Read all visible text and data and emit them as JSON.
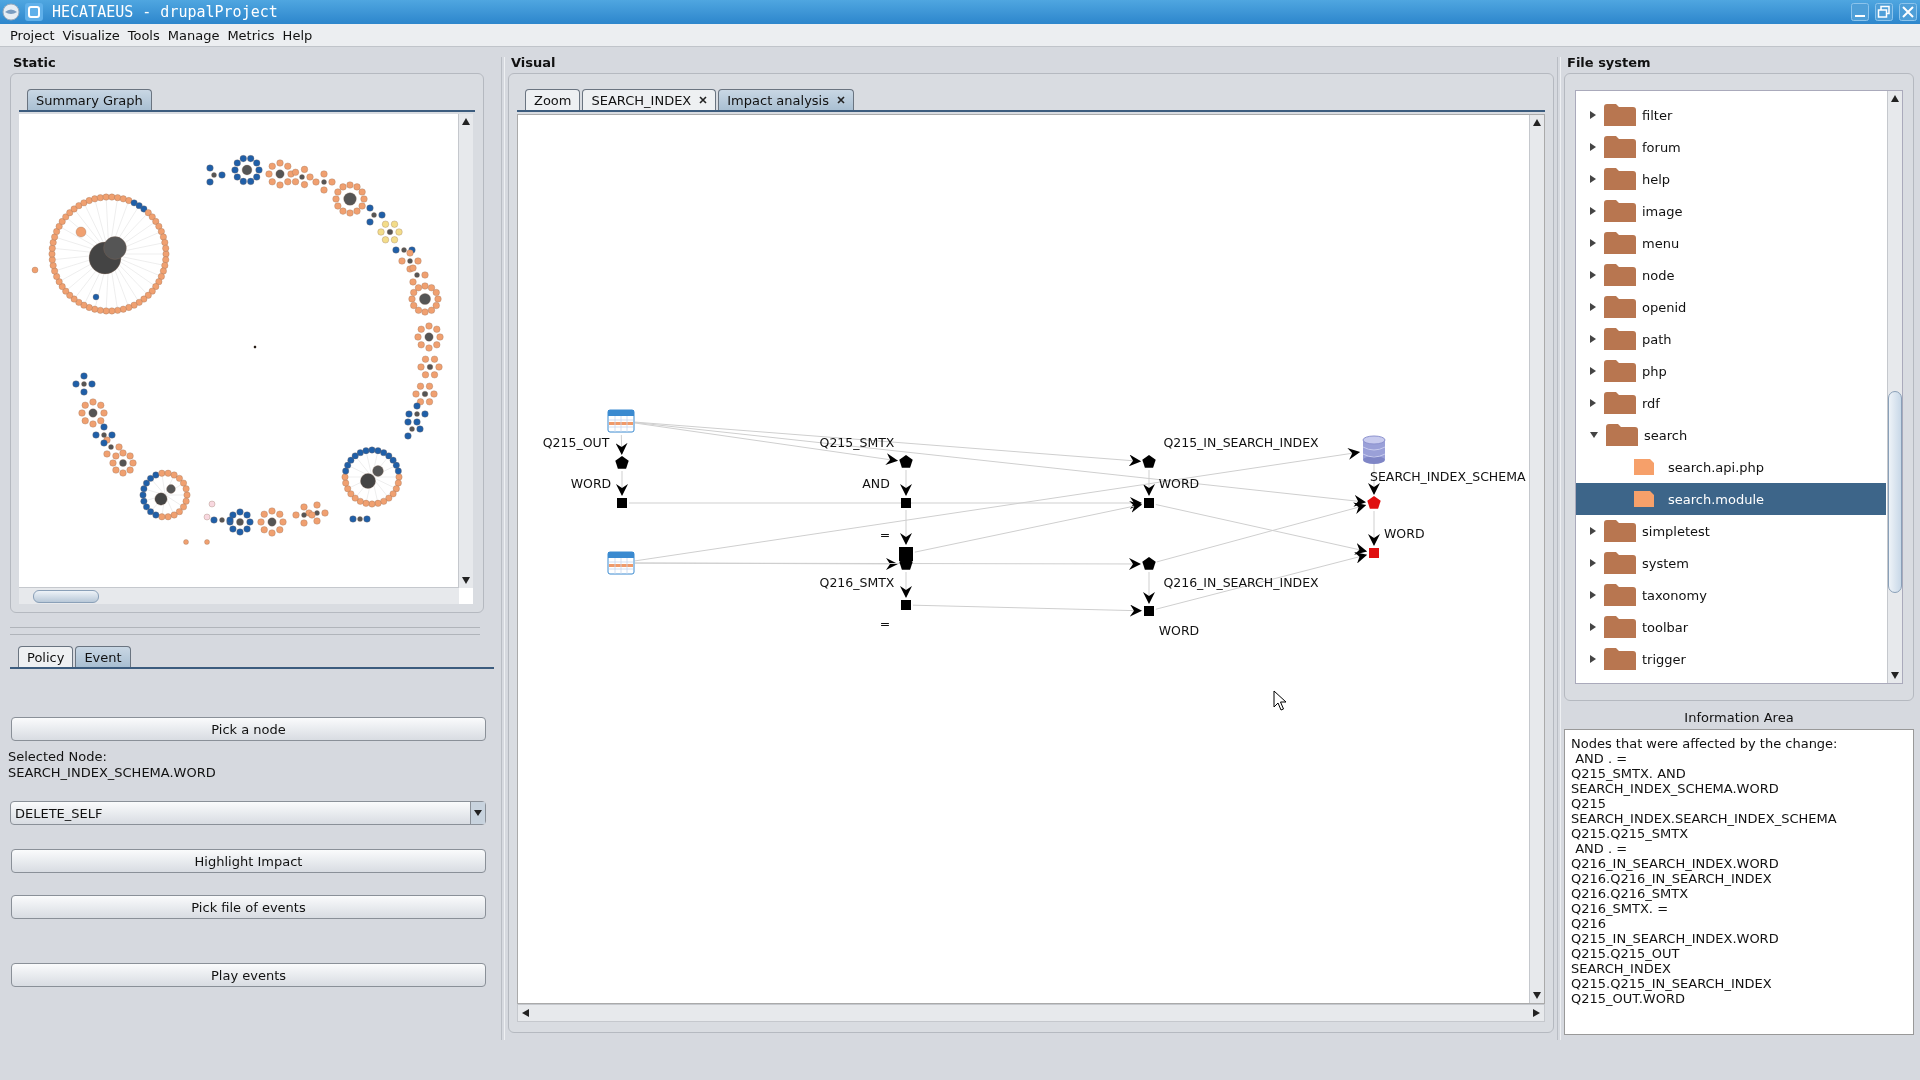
{
  "window": {
    "title": "HECATAEUS - drupalProject"
  },
  "menu": [
    "Project",
    "Visualize",
    "Tools",
    "Manage",
    "Metrics",
    "Help"
  ],
  "static_panel": {
    "title": "Static",
    "tabs": [
      {
        "label": "Summary Graph",
        "selected": true
      }
    ]
  },
  "event_panel": {
    "tabs": [
      {
        "label": "Policy",
        "selected": false
      },
      {
        "label": "Event",
        "selected": true
      }
    ],
    "controls": [
      {
        "kind": "button",
        "label": "Pick a node"
      },
      {
        "kind": "info",
        "lines": [
          "Selected Node:",
          "SEARCH_INDEX_SCHEMA.WORD"
        ]
      },
      {
        "kind": "dropdown",
        "value": "DELETE_SELF"
      },
      {
        "kind": "button",
        "label": "Highlight Impact"
      },
      {
        "kind": "button",
        "label": "Pick file of events"
      },
      {
        "kind": "button",
        "label": "Play events"
      }
    ]
  },
  "visual_panel": {
    "title": "Visual",
    "tabs": [
      {
        "label": "Zoom",
        "closable": false,
        "selected": false
      },
      {
        "label": "SEARCH_INDEX",
        "closable": true,
        "selected": false
      },
      {
        "label": "Impact analysis",
        "closable": true,
        "selected": true
      }
    ],
    "graph": {
      "nodes": [
        {
          "kind": "query"
        },
        {
          "kind": "relation",
          "label": "Q215_OUT",
          "affected": false
        },
        {
          "kind": "attribute",
          "label": "WORD",
          "affected": false
        },
        {
          "kind": "query"
        },
        {
          "kind": "relation",
          "label": "Q215_SMTX",
          "affected": false
        },
        {
          "kind": "attribute",
          "label": "AND",
          "affected": false
        },
        {
          "kind": "condition",
          "label": "=",
          "affected": false
        },
        {
          "kind": "relation",
          "label": "Q216_SMTX",
          "affected": false
        },
        {
          "kind": "attribute",
          "label": "=",
          "affected": false
        },
        {
          "kind": "relation",
          "label": "Q215_IN_SEARCH_INDEX",
          "affected": false
        },
        {
          "kind": "attribute",
          "label": "WORD",
          "affected": false
        },
        {
          "kind": "relation",
          "label": "Q216_IN_SEARCH_INDEX",
          "affected": false
        },
        {
          "kind": "attribute",
          "label": "WORD",
          "affected": false
        },
        {
          "kind": "database"
        },
        {
          "kind": "relation",
          "label": "SEARCH_INDEX_SCHEMA",
          "affected": true
        },
        {
          "kind": "attribute",
          "label": "WORD",
          "affected": true
        }
      ]
    }
  },
  "file_system": {
    "title": "File system",
    "tree": [
      {
        "label": "filter",
        "kind": "folder",
        "expanded": false,
        "selected": false
      },
      {
        "label": "forum",
        "kind": "folder",
        "expanded": false,
        "selected": false
      },
      {
        "label": "help",
        "kind": "folder",
        "expanded": false,
        "selected": false
      },
      {
        "label": "image",
        "kind": "folder",
        "expanded": false,
        "selected": false
      },
      {
        "label": "menu",
        "kind": "folder",
        "expanded": false,
        "selected": false
      },
      {
        "label": "node",
        "kind": "folder",
        "expanded": false,
        "selected": false
      },
      {
        "label": "openid",
        "kind": "folder",
        "expanded": false,
        "selected": false
      },
      {
        "label": "path",
        "kind": "folder",
        "expanded": false,
        "selected": false
      },
      {
        "label": "php",
        "kind": "folder",
        "expanded": false,
        "selected": false
      },
      {
        "label": "rdf",
        "kind": "folder",
        "expanded": false,
        "selected": false
      },
      {
        "label": "search",
        "kind": "folder",
        "expanded": true,
        "selected": false,
        "children": [
          {
            "label": "search.api.php",
            "kind": "file",
            "selected": false
          },
          {
            "label": "search.module",
            "kind": "file",
            "selected": true
          }
        ]
      },
      {
        "label": "simpletest",
        "kind": "folder",
        "expanded": false,
        "selected": false
      },
      {
        "label": "system",
        "kind": "folder",
        "expanded": false,
        "selected": false
      },
      {
        "label": "taxonomy",
        "kind": "folder",
        "expanded": false,
        "selected": false
      },
      {
        "label": "toolbar",
        "kind": "folder",
        "expanded": false,
        "selected": false
      },
      {
        "label": "trigger",
        "kind": "folder",
        "expanded": false,
        "selected": false
      }
    ]
  },
  "information_area": {
    "title": "Information Area",
    "lines": [
      "Nodes that were affected by the change:",
      " AND . =",
      "Q215_SMTX. AND",
      "SEARCH_INDEX_SCHEMA.WORD",
      "Q215",
      "SEARCH_INDEX.SEARCH_INDEX_SCHEMA",
      "Q215.Q215_SMTX",
      " AND . =",
      "Q216_IN_SEARCH_INDEX.WORD",
      "Q216.Q216_IN_SEARCH_INDEX",
      "Q216.Q216_SMTX",
      "Q216_SMTX. =",
      "Q216",
      "Q215_IN_SEARCH_INDEX.WORD",
      "Q215.Q215_OUT",
      "SEARCH_INDEX",
      "Q215.Q215_IN_SEARCH_INDEX",
      "Q215_OUT.WORD"
    ]
  }
}
